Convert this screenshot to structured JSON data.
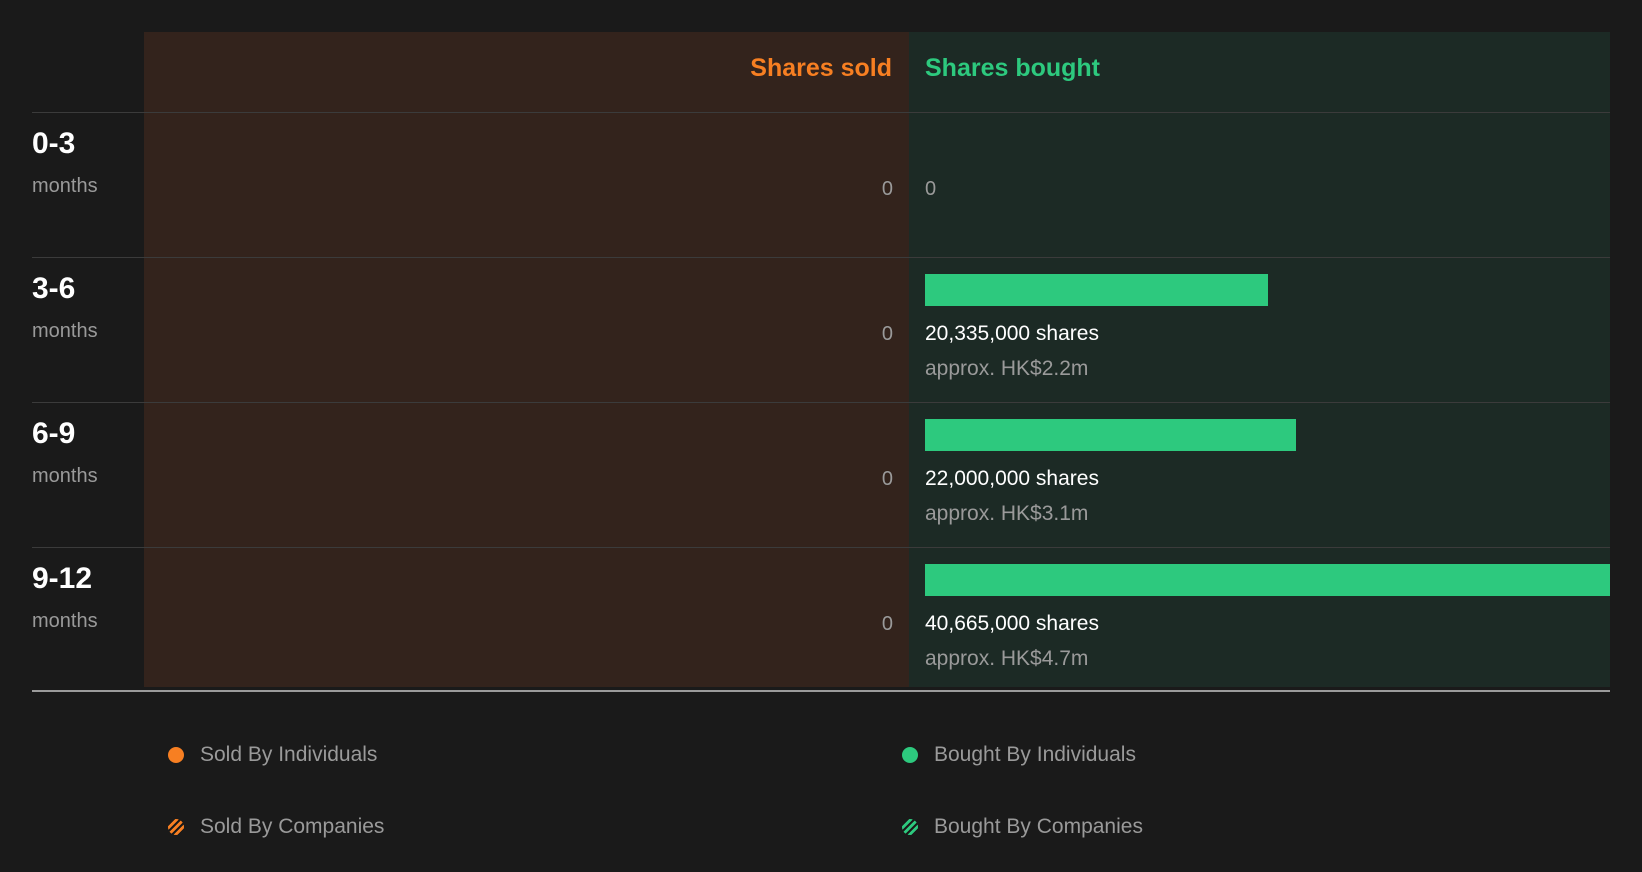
{
  "chart_data": {
    "type": "bar",
    "headers": {
      "sold": "Shares sold",
      "bought": "Shares bought"
    },
    "categories": [
      {
        "period": "0-3",
        "unit": "months"
      },
      {
        "period": "3-6",
        "unit": "months"
      },
      {
        "period": "6-9",
        "unit": "months"
      },
      {
        "period": "9-12",
        "unit": "months"
      }
    ],
    "series": [
      {
        "name": "Shares sold",
        "values": [
          0,
          0,
          0,
          0
        ],
        "labels": [
          "0",
          "0",
          "0",
          "0"
        ]
      },
      {
        "name": "Shares bought",
        "values": [
          0,
          20335000,
          22000000,
          40665000
        ],
        "labels": [
          "0",
          "20,335,000 shares",
          "22,000,000 shares",
          "40,665,000 shares"
        ],
        "approx": [
          "",
          "approx. HK$2.2m",
          "approx. HK$3.1m",
          "approx. HK$4.7m"
        ]
      }
    ],
    "legend": [
      {
        "label": "Sold By Individuals",
        "color": "#f77f22",
        "pattern": "solid"
      },
      {
        "label": "Bought By Individuals",
        "color": "#2dc97e",
        "pattern": "solid"
      },
      {
        "label": "Sold By Companies",
        "color": "#f77f22",
        "pattern": "striped"
      },
      {
        "label": "Bought By Companies",
        "color": "#2dc97e",
        "pattern": "striped"
      }
    ],
    "colors": {
      "sold": "#f77f22",
      "bought": "#2dc97e"
    }
  }
}
